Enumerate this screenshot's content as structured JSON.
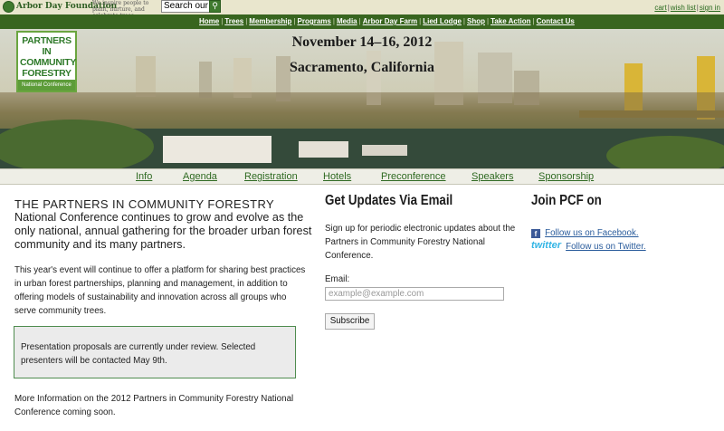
{
  "topbar": {
    "logo_icon": "tree-icon",
    "logo_text": "Arbor Day Foundation",
    "tagline": "We inspire people to plant, nurture, and celebrate trees.",
    "search_value": "Search our",
    "search_icon": "search-icon",
    "account": {
      "cart": "cart",
      "wishlist": "wish list",
      "signin": "sign in",
      "separator": "|"
    }
  },
  "nav": {
    "separator": "|",
    "items": [
      "Home",
      "Trees",
      "Membership",
      "Programs",
      "Media",
      "Arbor Day Farm",
      "Lied Lodge",
      "Shop",
      "Take Action",
      "Contact Us"
    ]
  },
  "banner": {
    "badge_title": "PARTNERS IN COMMUNITY FORESTRY",
    "badge_subtitle": "National Conference",
    "date": "November 14–16, 2012",
    "place": "Sacramento, California"
  },
  "subnav": {
    "items": [
      "Info",
      "Agenda",
      "Registration",
      "Hotels",
      "Preconference",
      "Speakers",
      "Sponsorship"
    ]
  },
  "main": {
    "heading": "THE PARTNERS IN COMMUNITY FORESTRY",
    "intro": "National Conference continues to grow and evolve as the only national, annual gathering for the broader urban forest community and its many partners.",
    "body": "This year's event will continue to offer a platform for sharing best practices in urban forest partnerships, planning and management, in addition to offering models of sustainability and innovation across all groups who serve community trees.",
    "notice": "Presentation proposals are currently under review. Selected presenters will be contacted May 9th.",
    "more": "More Information on the 2012 Partners in Community Forestry National Conference coming soon."
  },
  "updates": {
    "heading": "Get Updates Via Email",
    "text": "Sign up for periodic electronic updates about the Partners in Community Forestry National Conference.",
    "email_label": "Email:",
    "email_placeholder": "example@example.com",
    "subscribe_label": "Subscribe"
  },
  "social": {
    "heading": "Join PCF on",
    "facebook_icon": "f",
    "facebook_link": "Follow us on Facebook.",
    "twitter_logo": "twitter",
    "twitter_link": "Follow us on Twitter."
  },
  "colors": {
    "nav_green": "#38651f",
    "topbar_tan": "#e9e6cd",
    "link_green": "#2f6a22",
    "link_blue": "#2a5c9c"
  }
}
